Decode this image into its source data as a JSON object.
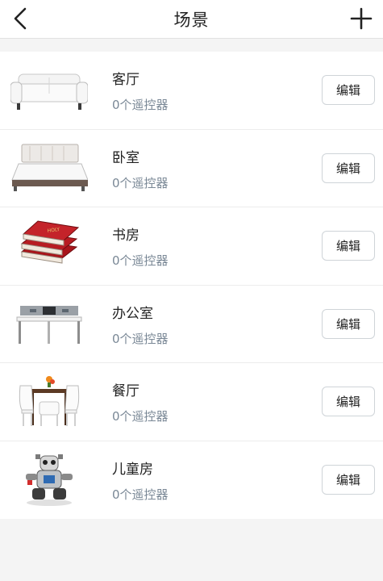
{
  "header": {
    "title": "场景",
    "back_icon": "chevron-left-icon",
    "add_icon": "plus-icon"
  },
  "scenes": [
    {
      "name": "客厅",
      "count": "0个遥控器",
      "edit_label": "编辑",
      "image": "sofa"
    },
    {
      "name": "卧室",
      "count": "0个遥控器",
      "edit_label": "编辑",
      "image": "bed"
    },
    {
      "name": "书房",
      "count": "0个遥控器",
      "edit_label": "编辑",
      "image": "books"
    },
    {
      "name": "办公室",
      "count": "0个遥控器",
      "edit_label": "编辑",
      "image": "office-desk"
    },
    {
      "name": "餐厅",
      "count": "0个遥控器",
      "edit_label": "编辑",
      "image": "dining-table"
    },
    {
      "name": "儿童房",
      "count": "0个遥控器",
      "edit_label": "编辑",
      "image": "toy-robot"
    }
  ]
}
